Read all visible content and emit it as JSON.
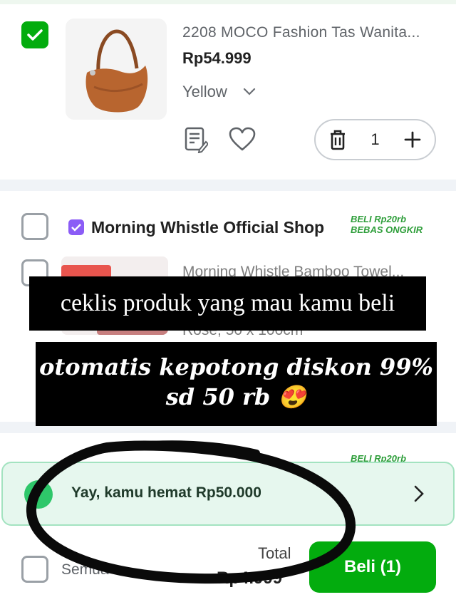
{
  "product1": {
    "name": "2208 MOCO Fashion Tas Wanita...",
    "price": "Rp54.999",
    "variant": "Yellow",
    "quantity": "1",
    "checked": true
  },
  "shop": {
    "name": "Morning Whistle Official Shop",
    "promo_line1": "BELI Rp20rb",
    "promo_line2": "BEBAS ONGKIR"
  },
  "product2": {
    "name": "Morning Whistle Bamboo Towel...",
    "variant": "Rose, 50 x 100cm"
  },
  "shop2": {
    "promo_line1": "BELI Rp20rb"
  },
  "overlay": {
    "caption1": "ceklis produk yang mau kamu beli",
    "caption2_line1": "otomatis kepotong diskon 99%",
    "caption2_line2": "sd 50 rb 😍"
  },
  "savings": {
    "text": "Yay, kamu hemat Rp50.000"
  },
  "footer": {
    "select_all_label": "Semua",
    "total_label": "Total",
    "total_value": "Rp4.999",
    "buy_label": "Beli (1)"
  },
  "colors": {
    "primary": "#03ac0e",
    "savings_bg": "#e6f7ee",
    "promo_green": "#2e9e3a"
  }
}
